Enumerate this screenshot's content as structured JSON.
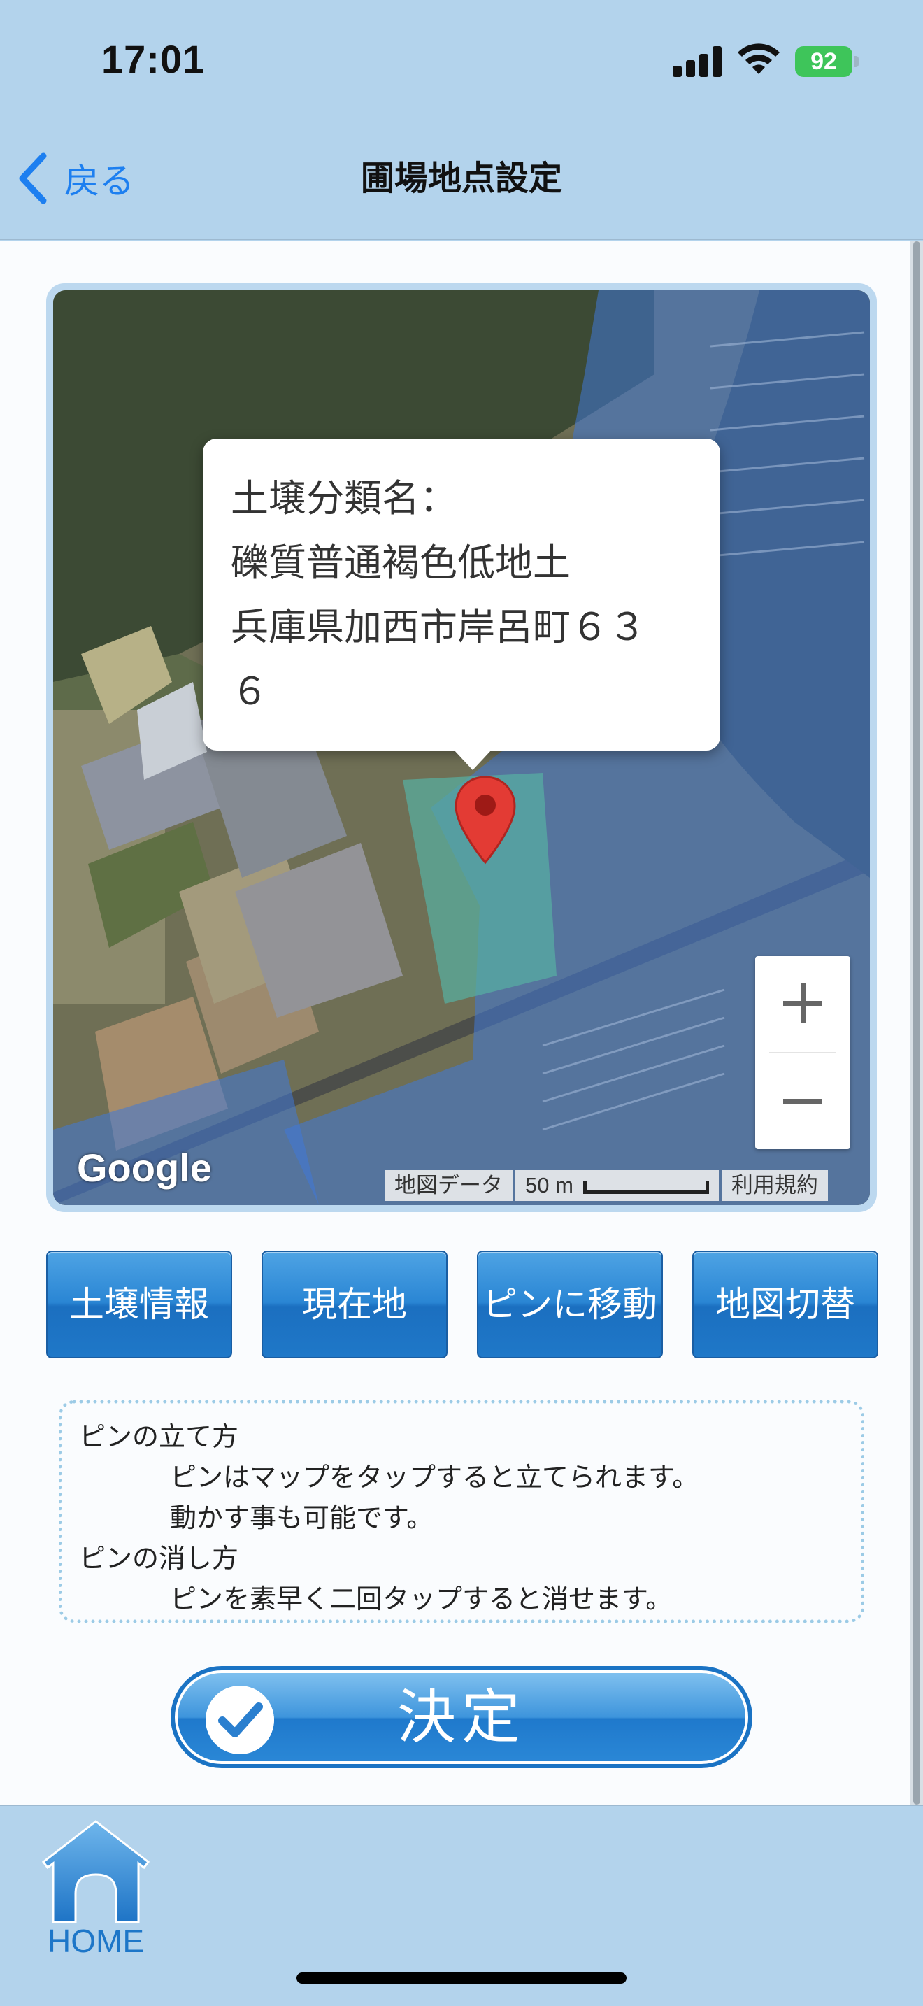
{
  "status_bar": {
    "time": "17:01",
    "battery": "92"
  },
  "nav": {
    "back_label": "戻る",
    "title": "圃場地点設定"
  },
  "map": {
    "info_window": {
      "lines": [
        "土壌分類名：",
        "礫質普通褐色低地土",
        "兵庫県加西市岸呂町６３",
        "６"
      ]
    },
    "zoom_in_label": "+",
    "zoom_out_label": "−",
    "google_logo": "Google",
    "attribution": {
      "map_data": "地図データ",
      "scale": "50 m",
      "terms": "利用規約"
    }
  },
  "actions": [
    {
      "label": "土壌情報"
    },
    {
      "label": "現在地"
    },
    {
      "label": "ピンに移動"
    },
    {
      "label": "地図切替"
    }
  ],
  "instructions": {
    "pin_place_heading": "ピンの立て方",
    "pin_place_line1": "ピンはマップをタップすると立てられます。",
    "pin_place_line2": "動かす事も可能です。",
    "pin_remove_heading": "ピンの消し方",
    "pin_remove_line1": "ピンを素早く二回タップすると消せます。"
  },
  "confirm": {
    "label": "決定"
  },
  "tab_bar": {
    "home_label": "HOME"
  },
  "colors": {
    "header_bg": "#b3d3ec",
    "accent": "#1d7ff0",
    "button_blue": "#1f78c8",
    "soil_overlay": "#3f78d8",
    "marker_red": "#e33b34"
  }
}
